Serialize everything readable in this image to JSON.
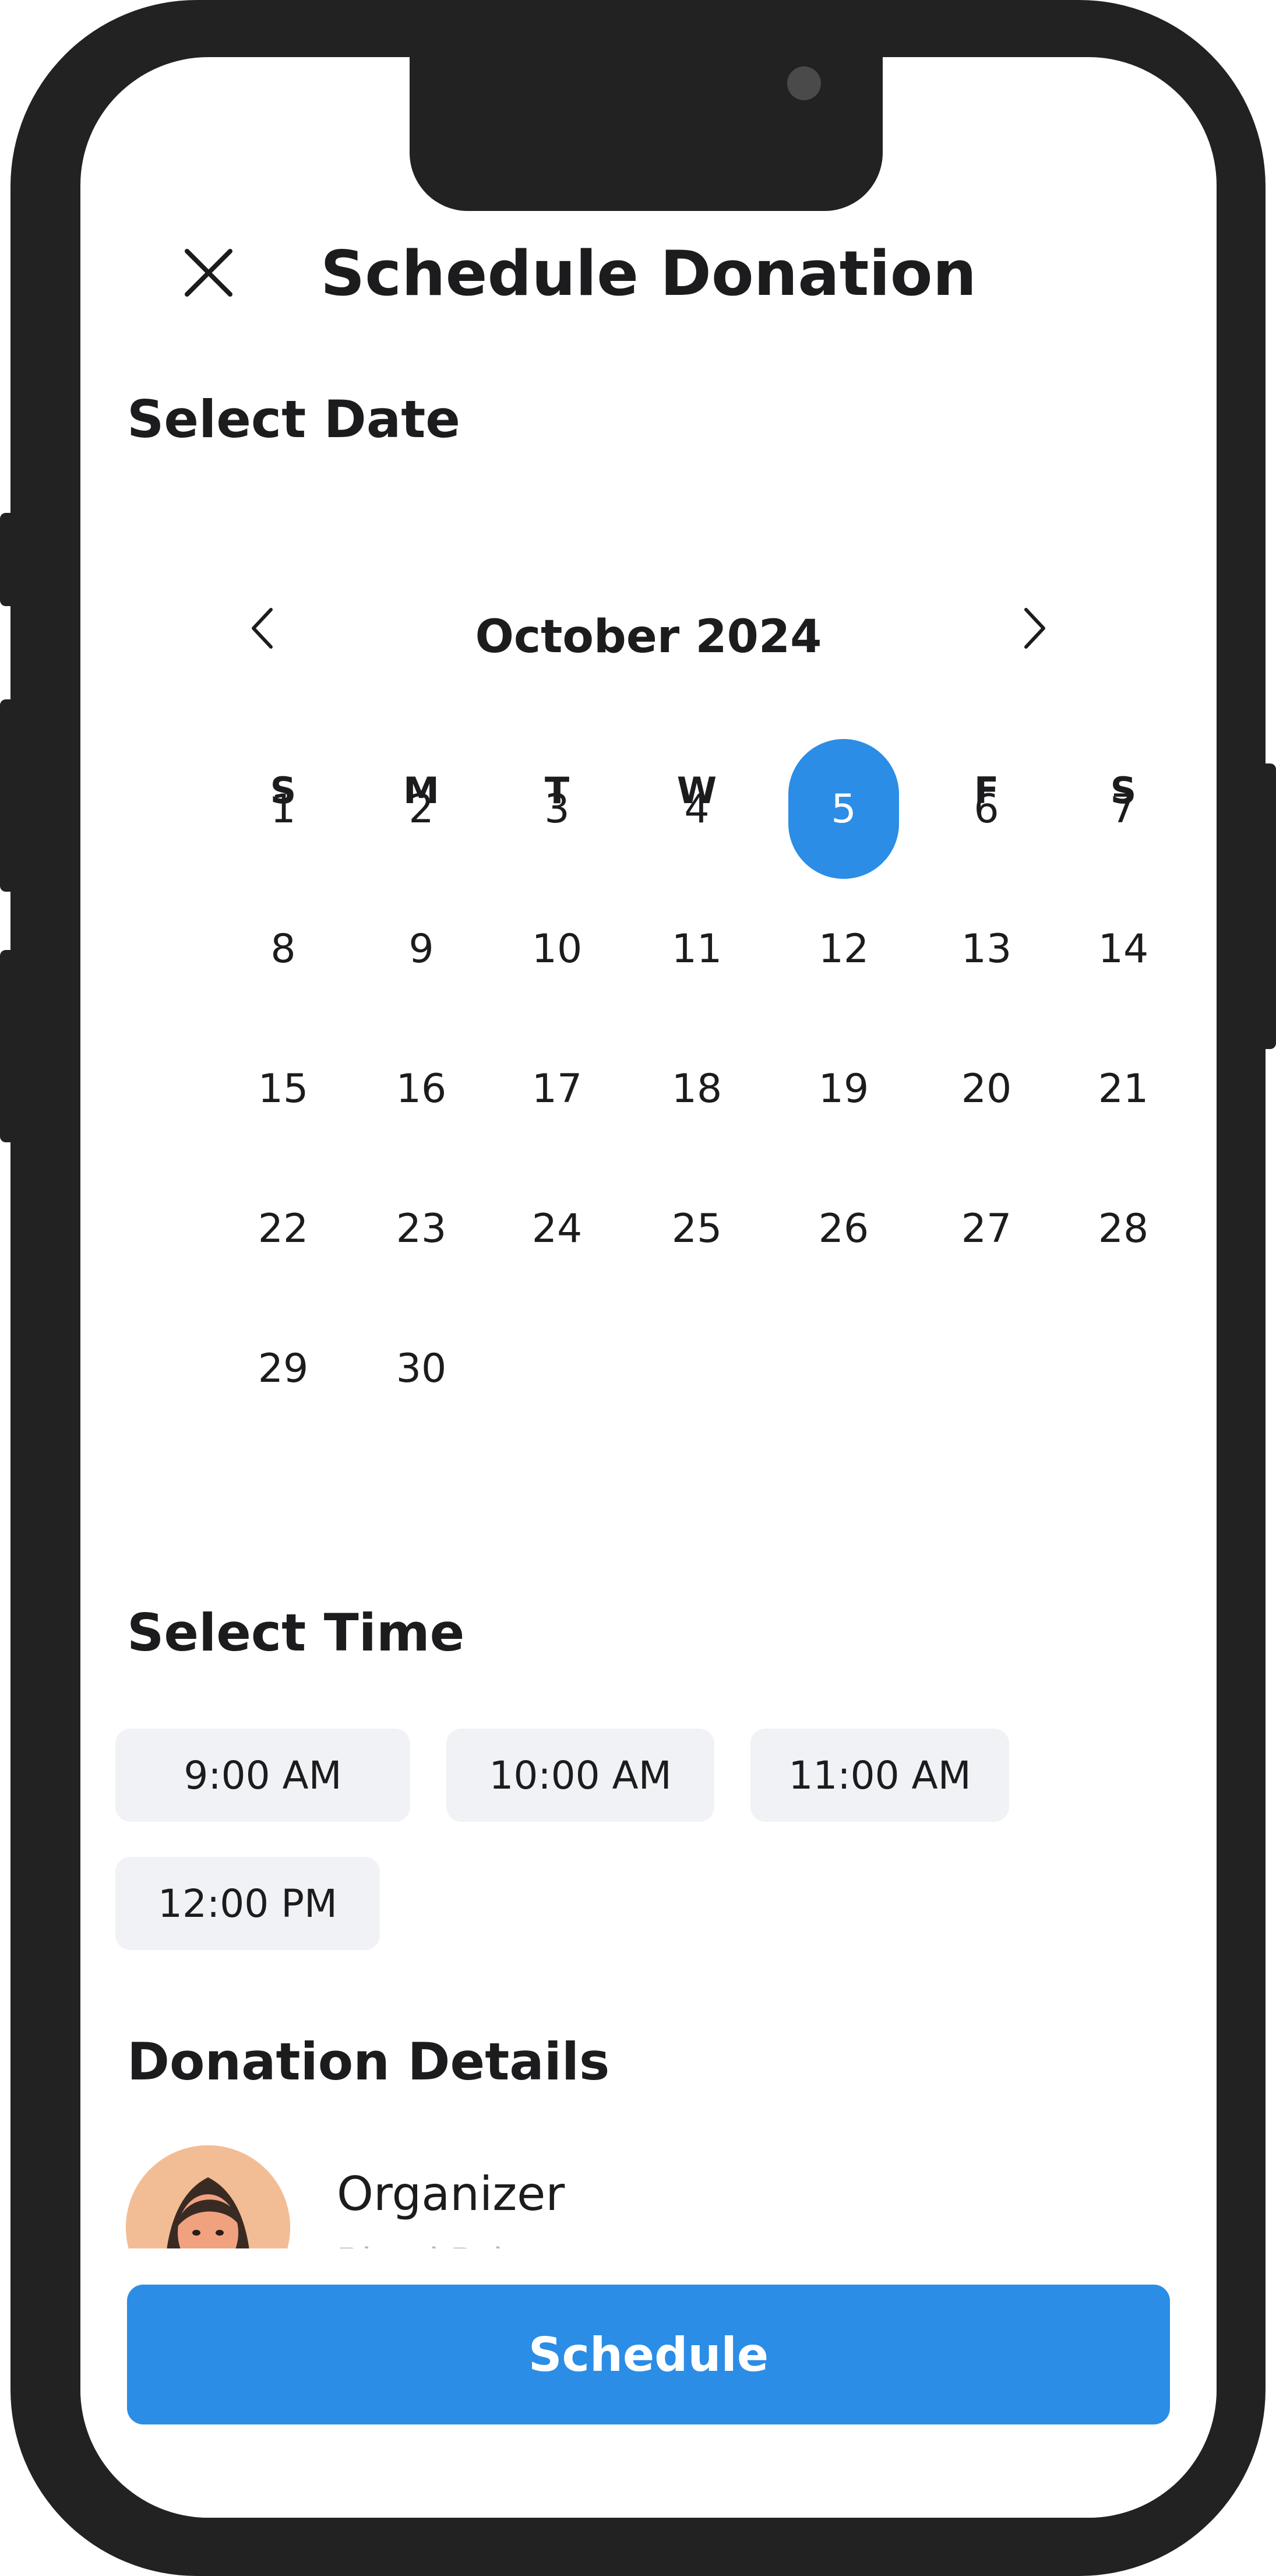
{
  "header": {
    "title": "Schedule Donation",
    "close_icon": "close-icon"
  },
  "date_section": {
    "title": "Select Date",
    "month": "October 2024",
    "prev_icon": "chevron-left-icon",
    "next_icon": "chevron-right-icon",
    "weekdays": [
      "S",
      "M",
      "T",
      "W",
      "T",
      "F",
      "S"
    ],
    "weeks": [
      [
        "1",
        "2",
        "3",
        "4",
        "5",
        "6",
        "7"
      ],
      [
        "8",
        "9",
        "10",
        "11",
        "12",
        "13",
        "14"
      ],
      [
        "15",
        "16",
        "17",
        "18",
        "19",
        "20",
        "21"
      ],
      [
        "22",
        "23",
        "24",
        "25",
        "26",
        "27",
        "28"
      ],
      [
        "29",
        "30"
      ]
    ],
    "selected_day": "5",
    "selected_color": "#2b8de6"
  },
  "time_section": {
    "title": "Select Time",
    "slots": [
      "9:00 AM",
      "10:00 AM",
      "11:00 AM",
      "12:00 PM"
    ]
  },
  "details_section": {
    "title": "Donation Details",
    "organizer_label": "Organizer",
    "organizer_sub": "Blood Drive"
  },
  "footer": {
    "schedule_label": "Schedule",
    "accent_color": "#2b8de6"
  }
}
